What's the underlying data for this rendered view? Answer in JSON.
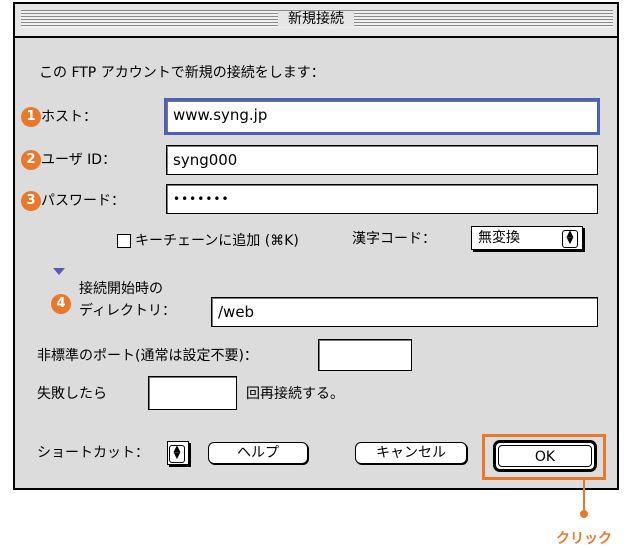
{
  "window": {
    "title": "新規接続"
  },
  "intro": "この FTP アカウントで新規の接続をします：",
  "host": {
    "badge": "1",
    "label": "ホスト：",
    "value": "www.syng.jp"
  },
  "user": {
    "badge": "2",
    "label": "ユーザ ID：",
    "value": "syng000"
  },
  "password": {
    "badge": "3",
    "label": "パスワード：",
    "value": "•••••••"
  },
  "keychain": {
    "label": "キーチェーンに追加 (⌘K)",
    "checked": false
  },
  "kanji": {
    "label": "漢字コード：",
    "selected": "無変換"
  },
  "directory": {
    "badge": "4",
    "label_line1": "接続開始時の",
    "label_line2": "ディレクトリ：",
    "value": "/web"
  },
  "port": {
    "label": "非標準のポート(通常は設定不要)：",
    "value": ""
  },
  "retry": {
    "label_before": "失敗したら",
    "value": "",
    "label_after": "回再接続する。"
  },
  "shortcut": {
    "label": "ショートカット："
  },
  "buttons": {
    "help": "ヘルプ",
    "cancel": "キャンセル",
    "ok": "OK"
  },
  "annotation": {
    "click": "クリック"
  },
  "colors": {
    "accent_orange": "#e8792a",
    "focus_blue": "#4a5fbf"
  }
}
